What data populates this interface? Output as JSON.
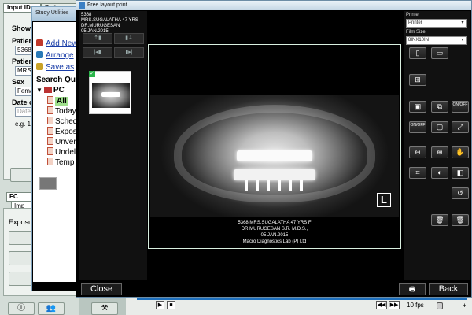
{
  "background_app": {
    "tabs": [
      "Input ID",
      "Patien"
    ],
    "show_label": "Show t",
    "patient_id_label": "Patient",
    "patient_id_value": "5368",
    "patient_name_label": "Patient",
    "patient_name_value": "MRS.S",
    "sex_label": "Sex",
    "sex_value": "Female",
    "dob_label": "Date of",
    "dob_placeholder": "Date o",
    "date_example": "e.g. 15.",
    "lower_tabs": [
      "FC",
      "Imp"
    ],
    "exposure_label": "Exposur",
    "bottom_buttons": [
      "ⓘ",
      "👥",
      "⚒"
    ]
  },
  "player": {
    "fps": "10 fps",
    "controls": [
      "▶",
      "■"
    ],
    "right_controls": [
      "◀◀",
      "▶▶",
      "↔"
    ],
    "slider_minus": "−",
    "slider_plus": "+"
  },
  "study_utilities": {
    "title": "Study Utilities",
    "links": [
      {
        "label": "Add New",
        "color": "#c0392b"
      },
      {
        "label": "Arrange",
        "color": "#2a7ab8"
      },
      {
        "label": "Save as",
        "color": "#c9a227"
      }
    ],
    "search_heading": "Search Que",
    "pc_label": "PC",
    "tree_items": [
      {
        "label": "All",
        "selected": true
      },
      {
        "label": "Today",
        "selected": false
      },
      {
        "label": "Sched",
        "selected": false
      },
      {
        "label": "Expos",
        "selected": false
      },
      {
        "label": "Unver",
        "selected": false
      },
      {
        "label": "Undel",
        "selected": false
      },
      {
        "label": "Temp",
        "selected": false
      }
    ]
  },
  "free_layout_print": {
    "title": "Free layout print",
    "thumb_info": [
      "5368",
      "MRS.SUGALATHA 47 YRS",
      "DR.MURUGESAN",
      "05.JAN.2015"
    ],
    "caption": [
      "5368   MRS.SUGALATHA 47 YRS   F",
      "DR.MURUGESAN S.R.   M.D.S.,",
      "05.JAN.2015",
      "Macro Diagnostics Lab (P) Ltd"
    ],
    "l_marker": "L",
    "printer_label": "Printer",
    "printer_value": "Printer",
    "film_size_label": "Film Size",
    "film_size_value": "8INX10IN",
    "buttons": {
      "close": "Close",
      "back": "Back",
      "on_off": "ON/OFF"
    },
    "accent_color": "#d9efe0"
  }
}
